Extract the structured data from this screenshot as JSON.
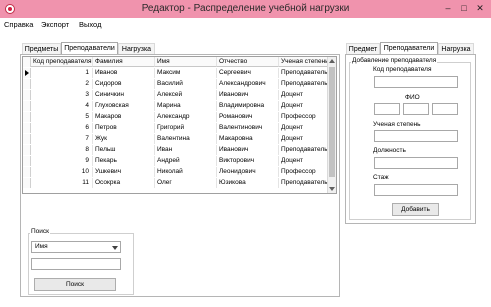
{
  "window": {
    "title": "Редактор - Распределение учебной нагрузки",
    "minimize": "–",
    "maximize": "□",
    "close": "✕"
  },
  "menu": [
    "Справка",
    "Экспорт",
    "Выход"
  ],
  "left_tabs": [
    "Предметы",
    "Преподаватели",
    "Нагрузка"
  ],
  "grid": {
    "columns": [
      "Код преподавателя",
      "Фамилия",
      "Имя",
      "Отчество",
      "Ученая степень"
    ],
    "rows": [
      [
        "1",
        "Иванов",
        "Максим",
        "Сергеевич",
        "Преподаватель"
      ],
      [
        "2",
        "Сидоров",
        "Василий",
        "Александрович",
        "Преподаватель"
      ],
      [
        "3",
        "Синичкин",
        "Алексей",
        "Иванович",
        "Доцент"
      ],
      [
        "4",
        "Глуховская",
        "Марина",
        "Владимировна",
        "Доцент"
      ],
      [
        "5",
        "Макаров",
        "Александр",
        "Романович",
        "Профессор"
      ],
      [
        "6",
        "Петров",
        "Григорий",
        "Валентинович",
        "Доцент"
      ],
      [
        "7",
        "Жук",
        "Валентина",
        "Макаровна",
        "Доцент"
      ],
      [
        "8",
        "Пельш",
        "Иван",
        "Иванович",
        "Преподаватель"
      ],
      [
        "9",
        "Пекарь",
        "Андрей",
        "Викторович",
        "Доцент"
      ],
      [
        "10",
        "Ушкевич",
        "Николай",
        "Леонидович",
        "Профессор"
      ],
      [
        "11",
        "Осокрка",
        "Олег",
        "Юзикова",
        "Преподаватель"
      ]
    ]
  },
  "search": {
    "title": "Поиск",
    "combo_value": "Имя",
    "button": "Поиск"
  },
  "right_tabs": [
    "Предмет",
    "Преподаватели",
    "Нагрузка"
  ],
  "add_form": {
    "title": "Добавление преподавателя",
    "code_label": "Код преподавателя",
    "fio_label": "ФИО",
    "degree_label": "Ученая степень",
    "position_label": "Должность",
    "experience_label": "Стаж",
    "add_button": "Добавить"
  },
  "colors": {
    "titlebar": "#f093ad",
    "close_accent": "#d02040"
  }
}
